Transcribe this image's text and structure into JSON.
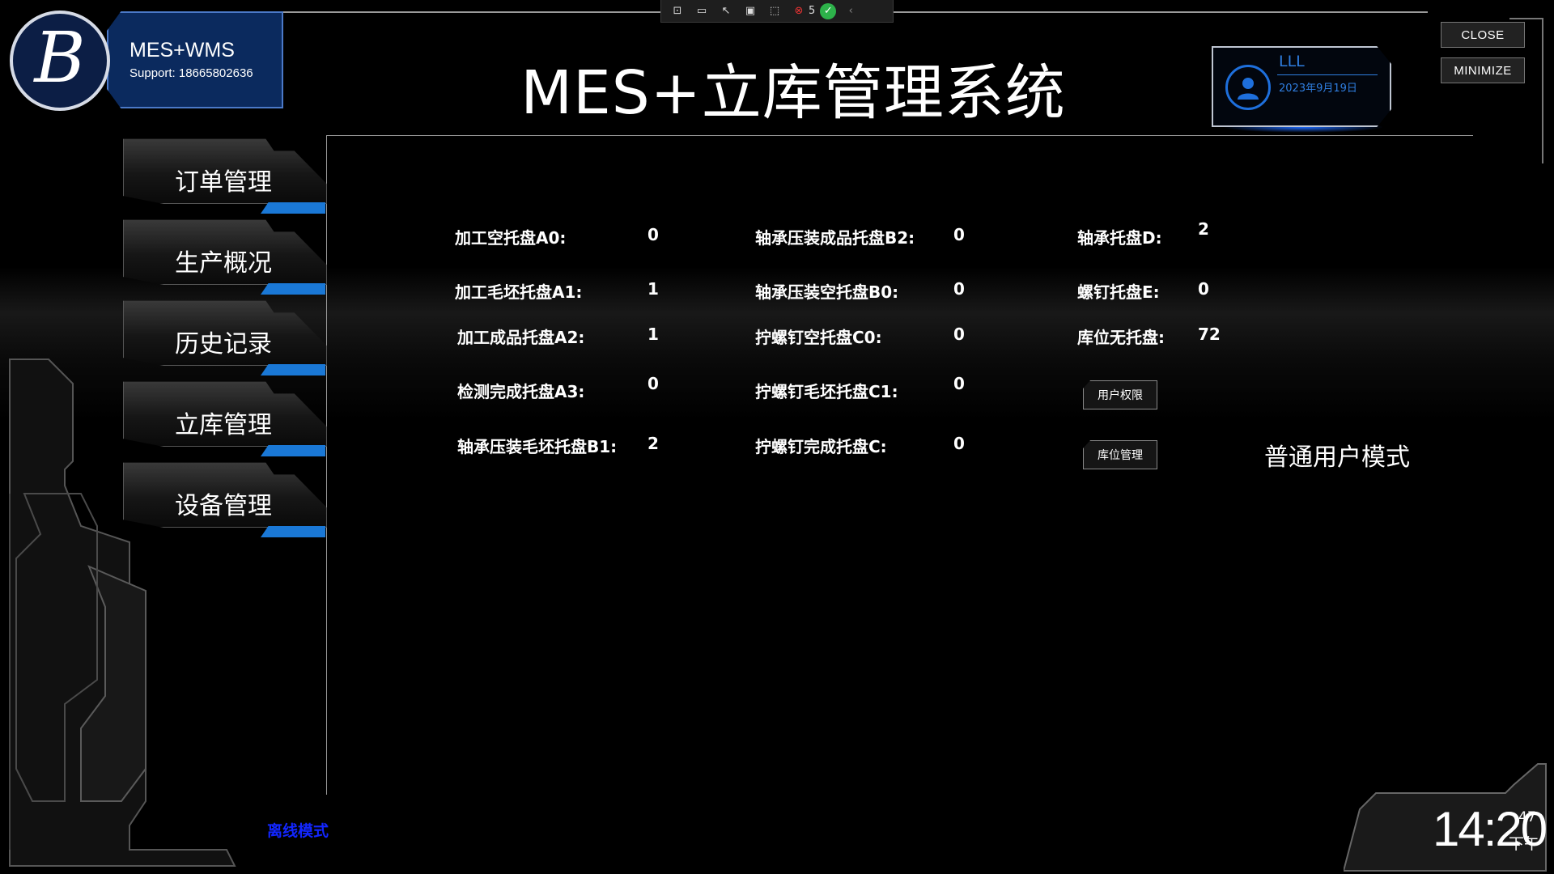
{
  "toolbar": {
    "items": [
      "select-element-icon",
      "video-icon",
      "cursor-icon",
      "frame-icon",
      "adorner-icon",
      "binding-error-icon",
      "check-icon",
      "chevron-left-icon"
    ],
    "error_count": "5"
  },
  "brand": {
    "logo_letter": "B",
    "title": "MES+WMS",
    "support": "Support: 18665802636"
  },
  "header": {
    "title": "MES+立库管理系统"
  },
  "user": {
    "name": "LLL",
    "date": "2023年9月19日"
  },
  "window": {
    "close_label": "CLOSE",
    "minimize_label": "MINIMIZE"
  },
  "nav": {
    "items": [
      {
        "label": "订单管理"
      },
      {
        "label": "生产概况"
      },
      {
        "label": "历史记录"
      },
      {
        "label": "立库管理"
      },
      {
        "label": "设备管理"
      }
    ]
  },
  "stats": {
    "col1": [
      {
        "label": "加工空托盘A0:",
        "value": "0"
      },
      {
        "label": "加工毛坯托盘A1:",
        "value": "1"
      },
      {
        "label": "加工成品托盘A2:",
        "value": "1"
      },
      {
        "label": "检测完成托盘A3:",
        "value": "0"
      },
      {
        "label": "轴承压装毛坯托盘B1:",
        "value": "2"
      }
    ],
    "col2": [
      {
        "label": "轴承压装成品托盘B2:",
        "value": "0"
      },
      {
        "label": "轴承压装空托盘B0:",
        "value": "0"
      },
      {
        "label": "拧螺钉空托盘C0:",
        "value": "0"
      },
      {
        "label": "拧螺钉毛坯托盘C1:",
        "value": "0"
      },
      {
        "label": "拧螺钉完成托盘C:",
        "value": "0"
      }
    ],
    "col3": [
      {
        "label": "轴承托盘D:",
        "value": "2"
      },
      {
        "label": "螺钉托盘E:",
        "value": "0"
      },
      {
        "label": "库位无托盘:",
        "value": "72"
      }
    ]
  },
  "actions": {
    "user_permission": "用户权限",
    "location_management": "库位管理"
  },
  "mode": {
    "label": "普通用户模式"
  },
  "status": {
    "offline": "离线模式"
  },
  "clock": {
    "time": "14:20",
    "seconds": "47",
    "ampm": "下午"
  },
  "colors": {
    "accent": "#1a78d6",
    "user_blue": "#2f7ee0",
    "offline_blue": "#1226ff",
    "background": "#000000"
  }
}
